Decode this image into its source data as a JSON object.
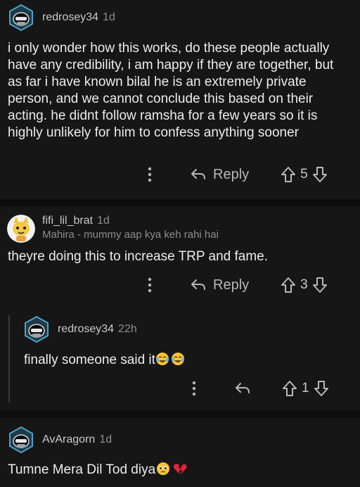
{
  "comments": [
    {
      "username": "redrosey34",
      "time": "1d",
      "text": "i only wonder how this works, do these people actually have any credibility, i am happy if they are together, but as far i have known bilal he is an extremely private person, and we cannot conclude this based on their acting. he didnt follow ramsha for a few years so it is highly unlikely for him to confess anything sooner",
      "reply_label": "Reply",
      "score": "5"
    },
    {
      "username": "fifi_lil_brat",
      "time": "1d",
      "flair": "Mahira - mummy aap kya keh rahi hai",
      "text": "theyre doing this to increase TRP and fame.",
      "reply_label": "Reply",
      "score": "3"
    },
    {
      "username": "redrosey34",
      "time": "22h",
      "text": "finally someone said it",
      "score": "1"
    },
    {
      "username": "AvAragorn",
      "time": "1d",
      "text": "Tumne Mera Dil Tod diya"
    }
  ],
  "colors": {
    "background": "#161616",
    "separator": "#0d0d0d",
    "avatar_ring": "#4aa3c8"
  }
}
